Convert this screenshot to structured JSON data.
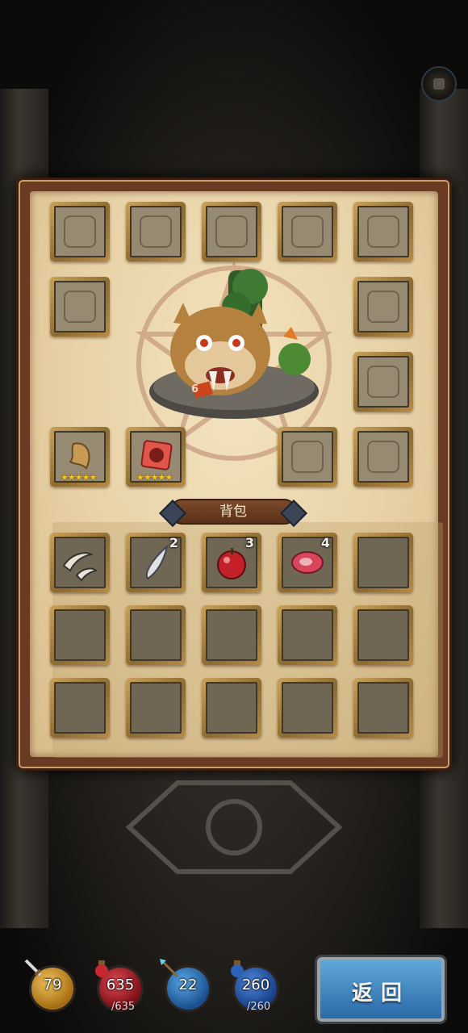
{
  "equipment": [
    {
      "slot": "slot-armor",
      "icon": "armor-silhouette-icon"
    },
    {
      "slot": "slot-chest",
      "icon": "chest-armor-silhouette-icon"
    },
    {
      "slot": "slot-helmet",
      "icon": "helmet-silhouette-icon"
    },
    {
      "slot": "slot-weapon",
      "icon": "crossbow-silhouette-icon"
    },
    {
      "slot": "slot-necklace",
      "icon": "necklace-silhouette-icon"
    },
    {
      "slot": "slot-belt",
      "icon": "belt-silhouette-icon"
    },
    {
      "slot": "slot-ring",
      "icon": "ring-silhouette-icon"
    },
    {
      "slot": "slot-cloak",
      "icon": "cloak-silhouette-icon"
    },
    {
      "slot": "slot-bag",
      "icon": "chest-silhouette-icon"
    },
    {
      "slot": "slot-boots",
      "icon": "boots-silhouette-icon"
    }
  ],
  "equipped": [
    {
      "name": "claw",
      "icon": "claw-icon",
      "stars": "★★★★★"
    },
    {
      "name": "meat-cube",
      "icon": "red-meat-cube-icon",
      "stars": "★★★★★"
    }
  ],
  "backpack": {
    "title": "背包",
    "items": [
      {
        "icon": "fangs-icon",
        "qty": ""
      },
      {
        "icon": "tooth-icon",
        "qty": "2"
      },
      {
        "icon": "apple-icon",
        "qty": "3"
      },
      {
        "icon": "steak-icon",
        "qty": "4"
      }
    ]
  },
  "monster": {
    "icon": "sabretooth-monster-icon",
    "badge": "6"
  },
  "stats": {
    "attack": {
      "value": "79",
      "icon": "sword-icon",
      "color": "#d9a33a"
    },
    "hp": {
      "value": "635",
      "max": "/635",
      "icon": "potion-icon",
      "color": "#b3232b"
    },
    "defense": {
      "value": "22",
      "icon": "spear-icon",
      "color": "#2f7cc4"
    },
    "mana": {
      "value": "260",
      "max": "/260",
      "icon": "mana-potion-icon",
      "color": "#2c62b7"
    }
  },
  "back_button": {
    "label": "返回"
  }
}
